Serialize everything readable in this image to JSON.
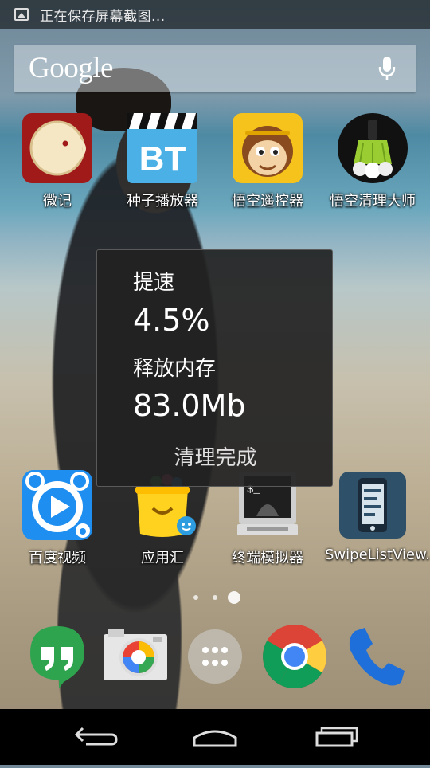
{
  "status_bar": {
    "notification_icon": "picture-icon",
    "text": "正在保存屏幕截图..."
  },
  "search": {
    "logo": "Google",
    "mic_icon": "microphone-icon"
  },
  "apps_row1": [
    {
      "label": "微记",
      "icon": "weiji-icon"
    },
    {
      "label": "种子播放器",
      "icon": "bt-player-icon"
    },
    {
      "label": "悟空遥控器",
      "icon": "monkey-remote-icon"
    },
    {
      "label": "悟空清理大师",
      "icon": "broom-cleaner-icon"
    }
  ],
  "apps_row2": [
    {
      "label": "百度视频",
      "icon": "baidu-video-icon"
    },
    {
      "label": "应用汇",
      "icon": "appchina-icon"
    },
    {
      "label": "终端模拟器",
      "icon": "terminal-icon"
    },
    {
      "label": "SwipeListView..",
      "icon": "swipelistview-icon"
    }
  ],
  "toast": {
    "speed_label": "提速",
    "speed_value": "4.5%",
    "memory_label": "释放内存",
    "memory_value": "83.0Mb",
    "status": "清理完成"
  },
  "pager": {
    "count": 3,
    "active_index": 2
  },
  "dock": [
    "hangouts-icon",
    "camera-icon",
    "all-apps-icon",
    "chrome-icon",
    "phone-icon"
  ],
  "nav": [
    "back-icon",
    "home-icon",
    "recents-icon"
  ]
}
